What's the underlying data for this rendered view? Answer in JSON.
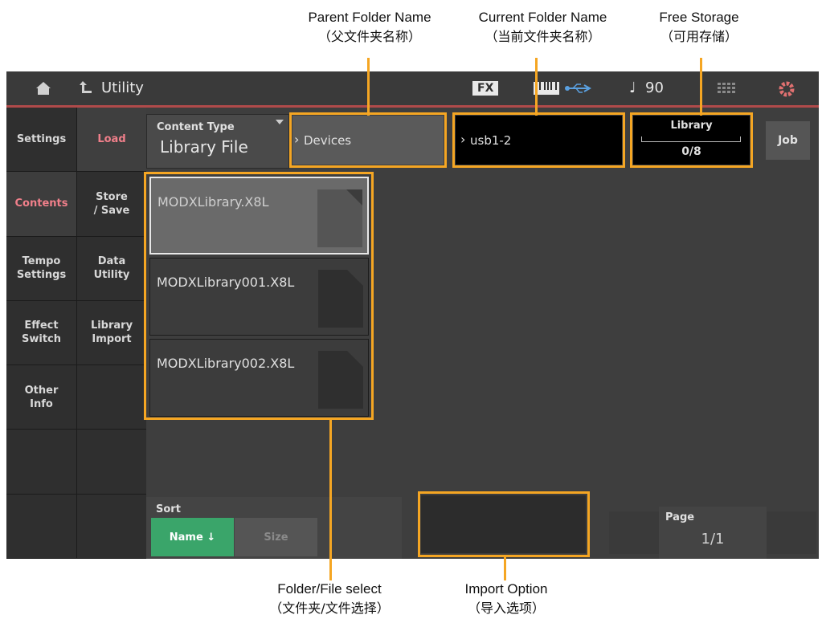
{
  "callouts": {
    "parent_folder": {
      "en": "Parent Folder Name",
      "zh": "（父文件夹名称）"
    },
    "current_folder": {
      "en": "Current Folder Name",
      "zh": "（当前文件夹名称）"
    },
    "free_storage": {
      "en": "Free Storage",
      "zh": "（可用存储）"
    },
    "file_select": {
      "en": "Folder/File select",
      "zh": "（文件夹/文件选择）"
    },
    "import_option": {
      "en": "Import Option",
      "zh": "（导入选项）"
    }
  },
  "topbar": {
    "title": "Utility",
    "fx": "FX",
    "tempo_note": "♩",
    "tempo": "90"
  },
  "sidebar_left": [
    "Settings",
    "Contents",
    "Tempo\nSettings",
    "Effect\nSwitch",
    "Other\nInfo",
    "",
    ""
  ],
  "sidebar_right": [
    "Load",
    "Store\n/ Save",
    "Data\nUtility",
    "Library\nImport",
    "",
    "",
    ""
  ],
  "content_type": {
    "label": "Content Type",
    "value": "Library File"
  },
  "parent_folder": "Devices",
  "current_folder": "usb1-2",
  "storage": {
    "label": "Library",
    "value": "0/8",
    "fill_fraction": 0
  },
  "job_label": "Job",
  "files": [
    "MODXLibrary.X8L",
    "MODXLibrary001.X8L",
    "MODXLibrary002.X8L"
  ],
  "sort": {
    "label": "Sort",
    "name_button": "Name ↓",
    "size_button": "Size"
  },
  "page": {
    "label": "Page",
    "value": "1/1"
  },
  "colors": {
    "accent_orange": "#f5a623",
    "active_pink": "#f07f8a",
    "sort_green": "#3aa56a",
    "topbar_red": "#b04a4a"
  }
}
